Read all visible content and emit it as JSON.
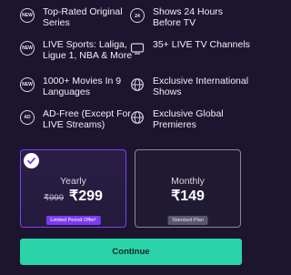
{
  "features": [
    {
      "icon": "new-badge-icon",
      "icon_text": "NEW",
      "label": "Top-Rated Original Series"
    },
    {
      "icon": "clock-24-icon",
      "icon_text": "",
      "label": "Shows 24 Hours Before TV"
    },
    {
      "icon": "new-badge-icon",
      "icon_text": "NEW",
      "label": "LIVE Sports: Laliga, Ligue 1, NBA & More"
    },
    {
      "icon": "tv-icon",
      "icon_text": "",
      "label": "35+ LIVE TV Channels"
    },
    {
      "icon": "new-badge-icon",
      "icon_text": "NEW",
      "label": "1000+ Movies In 9 Languages"
    },
    {
      "icon": "globe-icon",
      "icon_text": "",
      "label": "Exclusive International Shows"
    },
    {
      "icon": "ad-free-icon",
      "icon_text": "AD",
      "label": "AD-Free (Except For LIVE Streams)"
    },
    {
      "icon": "globe-icon",
      "icon_text": "",
      "label": "Exclusive Global Premieres"
    }
  ],
  "plans": {
    "yearly": {
      "name": "Yearly",
      "old_price": "₹999",
      "price": "₹299",
      "badge": "Limited Period Offer!",
      "selected": true
    },
    "monthly": {
      "name": "Monthly",
      "price": "₹149",
      "badge": "Standard Plan",
      "selected": false
    }
  },
  "continue_label": "Continue",
  "colors": {
    "background": "#1d1530",
    "accent_purple": "#7c3aed",
    "continue_green": "#2ad3a8"
  }
}
